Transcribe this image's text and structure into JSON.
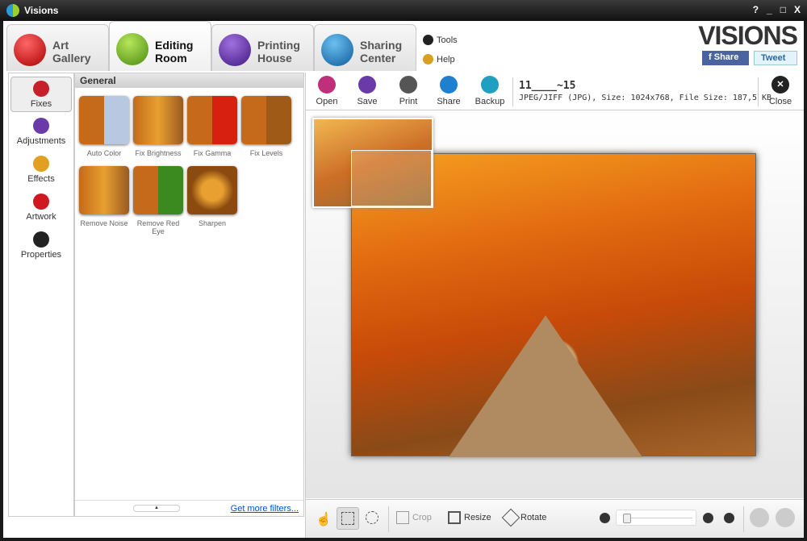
{
  "window": {
    "title": "Visions",
    "controls": [
      "?",
      "_",
      "□",
      "X"
    ]
  },
  "tabs": [
    {
      "label1": "Art",
      "label2": "Gallery",
      "color": "#c0181e"
    },
    {
      "label1": "Editing",
      "label2": "Room",
      "color": "#6fb21e",
      "active": true
    },
    {
      "label1": "Printing",
      "label2": "House",
      "color": "#5b2a9a"
    },
    {
      "label1": "Sharing",
      "label2": "Center",
      "color": "#1f7cc4"
    }
  ],
  "menu": {
    "tools": "Tools",
    "help": "Help"
  },
  "brand": {
    "logo": "VISIONS",
    "share": "Share",
    "tweet": "Tweet"
  },
  "sidebar": {
    "items": [
      {
        "label": "Fixes",
        "color": "#c8202a",
        "active": true
      },
      {
        "label": "Adjustments",
        "color": "#6a3aa8"
      },
      {
        "label": "Effects",
        "color": "#e0a020"
      },
      {
        "label": "Artwork",
        "color": "#d01820"
      },
      {
        "label": "Properties",
        "color": "#222"
      }
    ]
  },
  "filters": {
    "header": "General",
    "items": [
      "Auto Color",
      "Fix Brightness",
      "Fix Gamma",
      "Fix Levels",
      "Remove Noise",
      "Remove Red Eye",
      "Sharpen"
    ],
    "more": "Get more filters..."
  },
  "toolbar": {
    "buttons": [
      {
        "label": "Open",
        "color": "#c0307a"
      },
      {
        "label": "Save",
        "color": "#6a3aa8"
      },
      {
        "label": "Print",
        "color": "#555"
      },
      {
        "label": "Share",
        "color": "#2080d0"
      },
      {
        "label": "Backup",
        "color": "#20a0c0"
      }
    ],
    "close": "Close"
  },
  "file": {
    "name": "11____~15",
    "info": "JPEG/JIFF (JPG), Size: 1024x768, File Size: 187,5 KB"
  },
  "bottom": {
    "crop": "Crop",
    "resize": "Resize",
    "rotate": "Rotate",
    "zoom_level": 0.05
  }
}
